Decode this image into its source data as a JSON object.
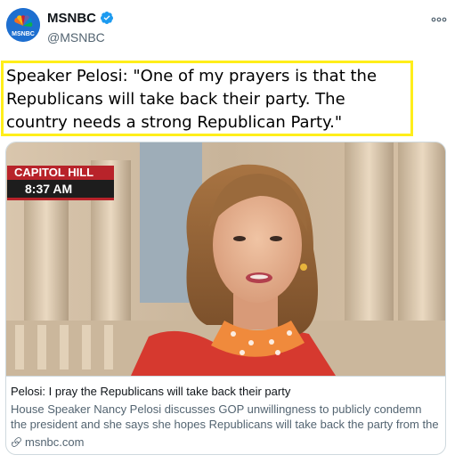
{
  "author": {
    "display_name": "MSNBC",
    "handle": "@MSNBC",
    "avatar_label": "MSNBC",
    "verified": true
  },
  "tweet": {
    "text": "Speaker Pelosi: \"One of my prayers is that the Republicans will take back their party. The country needs a strong Republican Party.\"",
    "highlight_color": "#ffee1a"
  },
  "media": {
    "lower_third_top": "CAPITOL HILL",
    "lower_third_bottom": "8:37 AM"
  },
  "link_card": {
    "title": "Pelosi: I pray the Republicans will take back their party",
    "description": "House Speaker Nancy Pelosi discusses GOP unwillingness to publicly condemn the president and she says she hopes Republicans will take back the party from the ...",
    "domain": "msnbc.com"
  },
  "icons": [
    "msnbc-peacock-icon",
    "verified-badge-icon",
    "more-options-icon",
    "link-icon"
  ],
  "colors": {
    "accent_blue": "#1d9bf0",
    "avatar_blue": "#1e6fd0",
    "lower_third_red": "#b8232a",
    "secondary_text": "#536471"
  }
}
